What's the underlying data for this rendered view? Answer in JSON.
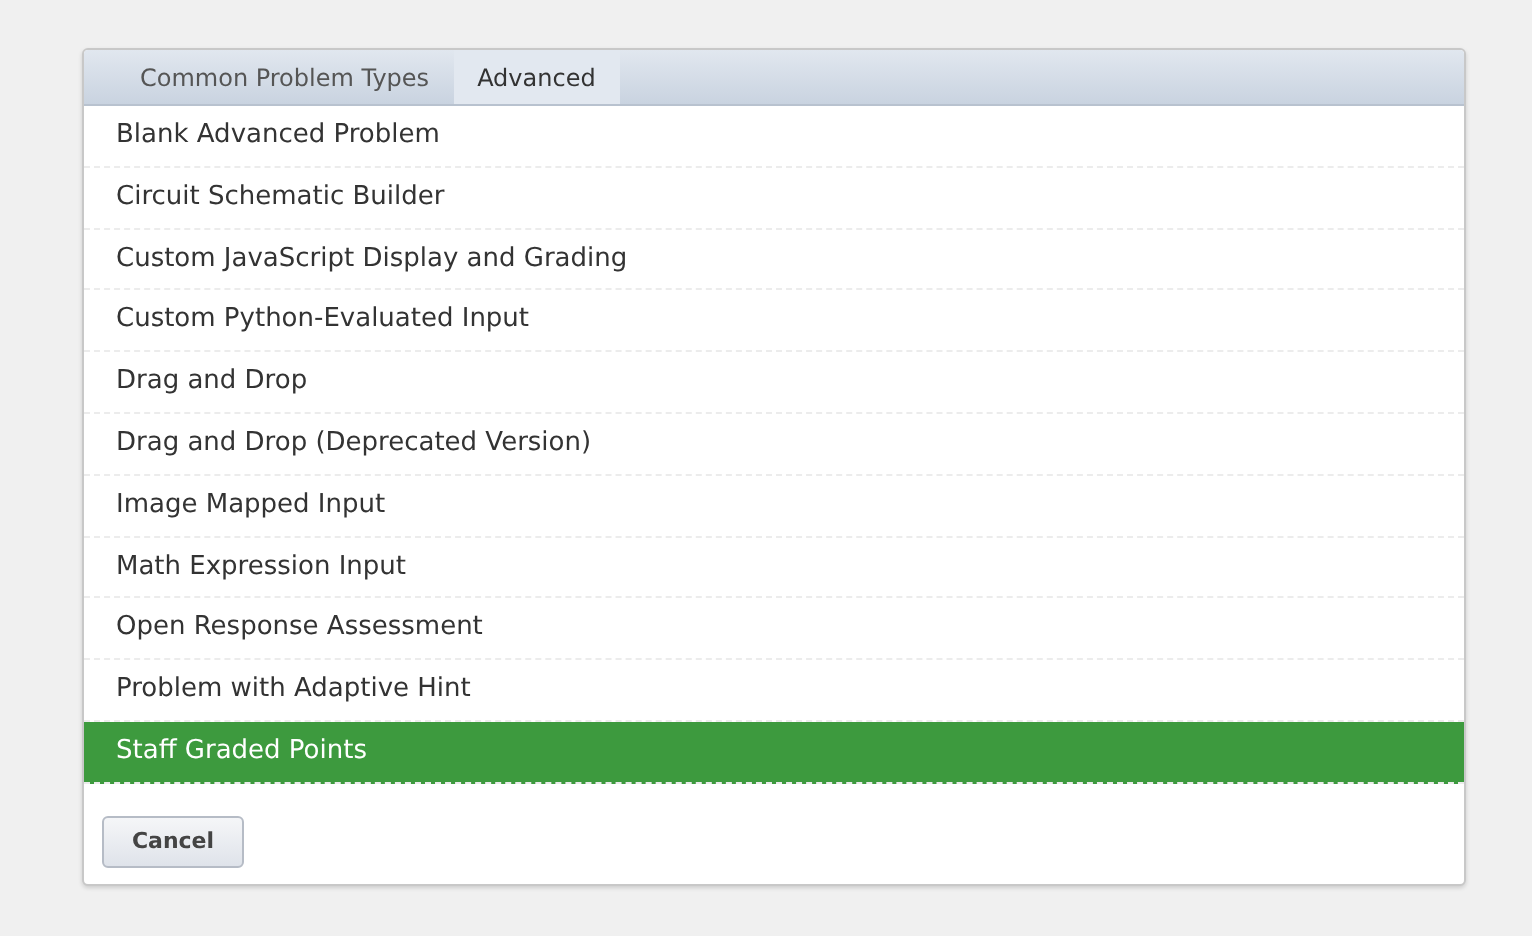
{
  "tabs": [
    {
      "label": "Common Problem Types",
      "selected": false
    },
    {
      "label": "Advanced",
      "selected": true
    }
  ],
  "items": [
    {
      "label": "Blank Advanced Problem",
      "selected": false
    },
    {
      "label": "Circuit Schematic Builder",
      "selected": false
    },
    {
      "label": "Custom JavaScript Display and Grading",
      "selected": false
    },
    {
      "label": "Custom Python-Evaluated Input",
      "selected": false
    },
    {
      "label": "Drag and Drop",
      "selected": false
    },
    {
      "label": "Drag and Drop (Deprecated Version)",
      "selected": false
    },
    {
      "label": "Image Mapped Input",
      "selected": false
    },
    {
      "label": "Math Expression Input",
      "selected": false
    },
    {
      "label": "Open Response Assessment",
      "selected": false
    },
    {
      "label": "Problem with Adaptive Hint",
      "selected": false
    },
    {
      "label": "Staff Graded Points",
      "selected": true
    }
  ],
  "buttons": [
    "Cancel"
  ]
}
